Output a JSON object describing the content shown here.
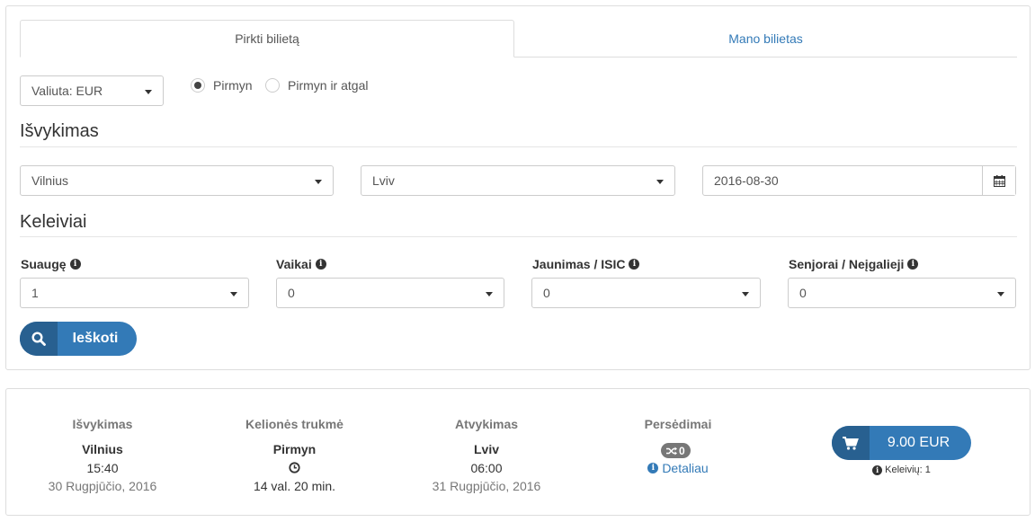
{
  "tabs": {
    "buy": "Pirkti bilietą",
    "my_ticket": "Mano bilietas"
  },
  "currency": {
    "value": "Valiuta: EUR"
  },
  "trip_type": {
    "one_way": "Pirmyn",
    "round_trip": "Pirmyn ir atgal",
    "selected": "one_way"
  },
  "departure_section": {
    "title": "Išvykimas",
    "from": "Vilnius",
    "to": "Lviv",
    "date": "2016-08-30"
  },
  "passengers_section": {
    "title": "Keleiviai",
    "adults": {
      "label": "Suaugę",
      "value": "1"
    },
    "kids": {
      "label": "Vaikai",
      "value": "0"
    },
    "youth": {
      "label": "Jaunimas / ISIC",
      "value": "0"
    },
    "seniors": {
      "label": "Senjorai / Neįgalieji",
      "value": "0"
    }
  },
  "search_button": {
    "label": "Ieškoti"
  },
  "result": {
    "departure": {
      "header": "Išvykimas",
      "city": "Vilnius",
      "time": "15:40",
      "date": "30 Rugpjūčio, 2016"
    },
    "duration": {
      "header": "Kelionės trukmė",
      "direction": "Pirmyn",
      "value": "14 val. 20 min."
    },
    "arrival": {
      "header": "Atvykimas",
      "city": "Lviv",
      "time": "06:00",
      "date": "31 Rugpjūčio, 2016"
    },
    "transfers": {
      "header": "Persėdimai",
      "count": "0",
      "details_label": "Detaliau"
    },
    "price": {
      "label": "9.00 EUR"
    },
    "passengers_count": "Keleivių: 1"
  },
  "colors": {
    "primary": "#337ab7",
    "primary_dark": "#286090",
    "muted": "#777777",
    "border": "#dddddd"
  },
  "icons": [
    "search-icon",
    "calendar-icon",
    "info-icon",
    "clock-icon",
    "shuffle-icon",
    "cart-icon",
    "caret-down-icon"
  ]
}
